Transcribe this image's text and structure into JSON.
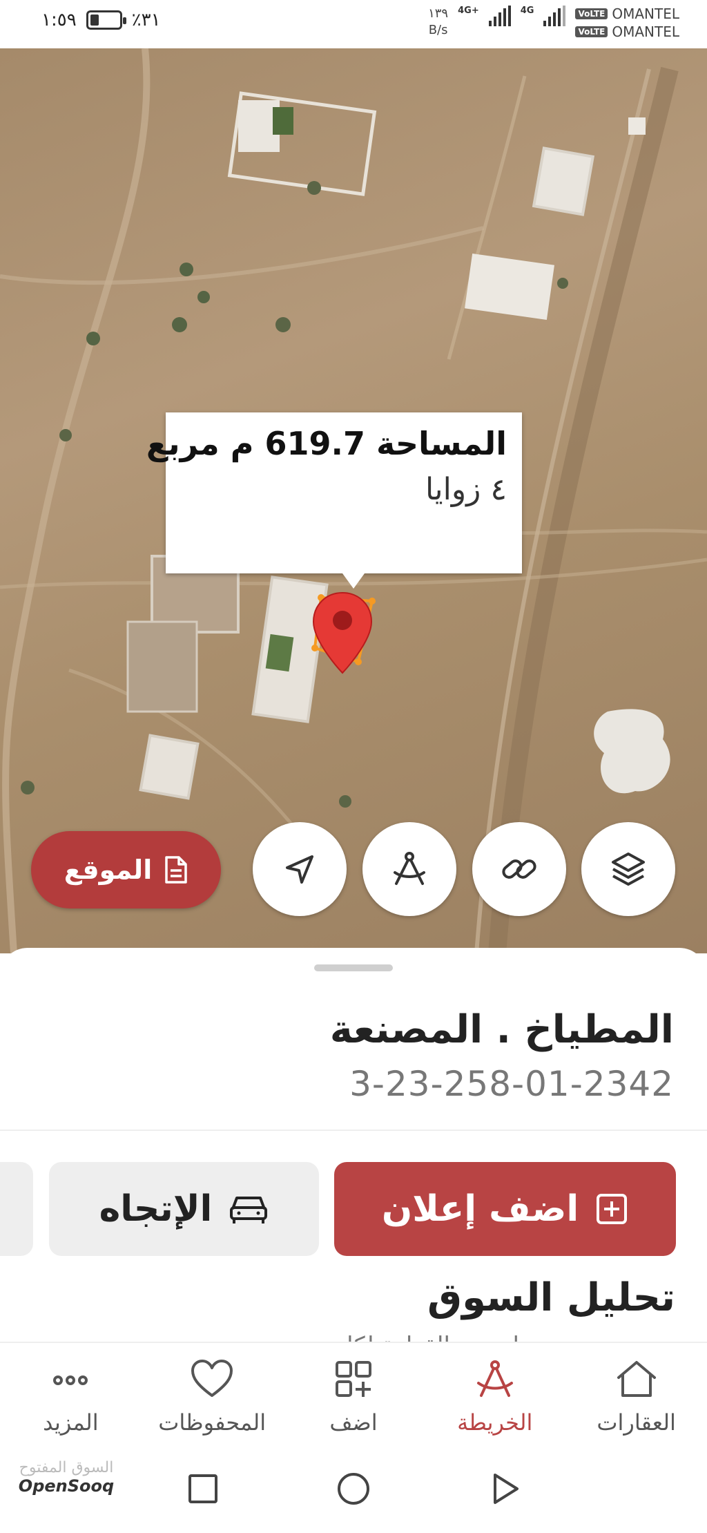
{
  "status_bar": {
    "time": "١:٥٩",
    "battery": "٪٣١",
    "battery_level": 0.31,
    "carriers": [
      "OMANTEL",
      "OMANTEL"
    ],
    "volte": "VoLTE",
    "network_1": "4G+",
    "network_2": "4G",
    "speed_value": "١٣٩",
    "speed_unit": "B/s"
  },
  "map": {
    "area_label": "المساحة 619.7 م مربع",
    "corners_label": "٤ زوايا",
    "location_button": "الموقع",
    "controls": [
      "navigate-icon",
      "measure-icon",
      "link-icon",
      "layers-icon"
    ],
    "plot_color": "#f59a23",
    "pin_color": "#e53935"
  },
  "sheet": {
    "title": "المطياخ . المصنعة",
    "code": "3-23-258-01-2342",
    "add_ad_label": "اضف إعلان",
    "direction_label": "الإتجاه",
    "market_title": "تحليل السوق",
    "market_subtitle": "متوسط سعر القطعة لكل متر"
  },
  "bottom_nav": {
    "items": [
      {
        "label": "العقارات",
        "icon": "home-icon"
      },
      {
        "label": "الخريطة",
        "icon": "compass-icon",
        "active": true
      },
      {
        "label": "اضف",
        "icon": "add-grid-icon"
      },
      {
        "label": "المحفوظات",
        "icon": "heart-icon"
      },
      {
        "label": "المزيد",
        "icon": "more-icon"
      }
    ]
  },
  "watermark": {
    "arabic": "السوق المفتوح",
    "english": "OpenSooq"
  },
  "colors": {
    "accent": "#b84444",
    "active_nav": "#b84444"
  }
}
